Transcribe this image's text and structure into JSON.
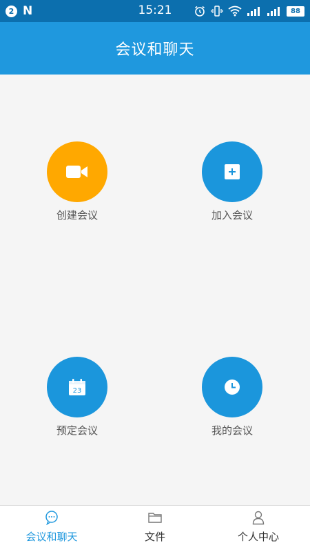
{
  "status_bar": {
    "notification_count": "2",
    "app_badge": "N",
    "time": "15:21",
    "icons": [
      "alarm-icon",
      "vibrate-icon",
      "wifi-icon",
      "signal-icon",
      "signal-icon"
    ],
    "battery": "88"
  },
  "header": {
    "title": "会议和聊天"
  },
  "actions": [
    {
      "label": "创建会议",
      "icon": "video-camera-icon",
      "color": "#ffa800"
    },
    {
      "label": "加入会议",
      "icon": "plus-square-icon",
      "color": "#1b96dc"
    },
    {
      "label": "预定会议",
      "icon": "calendar-icon",
      "color": "#1b96dc",
      "icon_text": "23"
    },
    {
      "label": "我的会议",
      "icon": "clock-icon",
      "color": "#1b96dc"
    }
  ],
  "bottom_nav": {
    "items": [
      {
        "label": "会议和聊天",
        "icon": "chat-bubble-icon",
        "active": true
      },
      {
        "label": "文件",
        "icon": "folder-icon",
        "active": false
      },
      {
        "label": "个人中心",
        "icon": "person-icon",
        "active": false
      }
    ]
  },
  "colors": {
    "status_bar": "#0c6fae",
    "header": "#1f98de",
    "active_tab": "#1f98de"
  }
}
